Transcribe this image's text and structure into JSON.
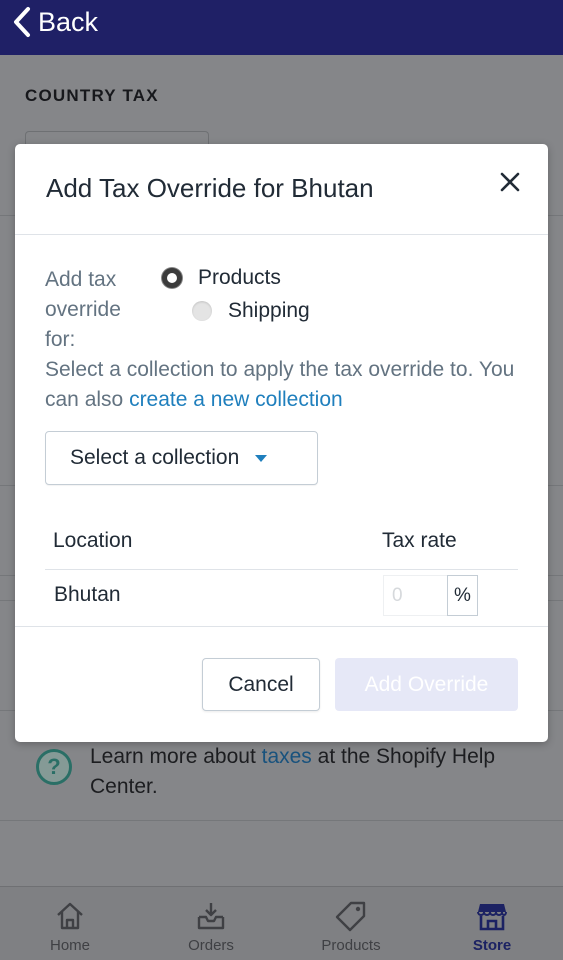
{
  "topbar": {
    "back_label": "Back"
  },
  "page": {
    "section_title": "COUNTRY TAX",
    "help": {
      "prefix": "Learn more about ",
      "link": "taxes",
      "suffix": " at the Shopify Help Center.",
      "icon": "question-circle-icon"
    }
  },
  "modal": {
    "title": "Add Tax Override for Bhutan",
    "for_label": "Add tax override for:",
    "options": [
      {
        "label": "Products",
        "selected": true
      },
      {
        "label": "Shipping",
        "selected": false
      }
    ],
    "description": "Select a collection to apply the tax override to. You can also ",
    "description_link": "create a new collection",
    "select_label": "Select a collection",
    "table": {
      "headers": {
        "location": "Location",
        "tax_rate": "Tax rate"
      },
      "rows": [
        {
          "location": "Bhutan",
          "rate_placeholder": "0",
          "unit": "%"
        }
      ]
    },
    "buttons": {
      "cancel": "Cancel",
      "add": "Add Override"
    }
  },
  "tabbar": {
    "tabs": [
      {
        "label": "Home",
        "icon": "home-icon"
      },
      {
        "label": "Orders",
        "icon": "orders-inbox-icon"
      },
      {
        "label": "Products",
        "icon": "tag-icon"
      },
      {
        "label": "Store",
        "icon": "store-icon",
        "active": true
      }
    ]
  },
  "colors": {
    "nav": "#1f2066",
    "link": "#1f7fbd",
    "disabled_button": "#e6e8f7"
  }
}
